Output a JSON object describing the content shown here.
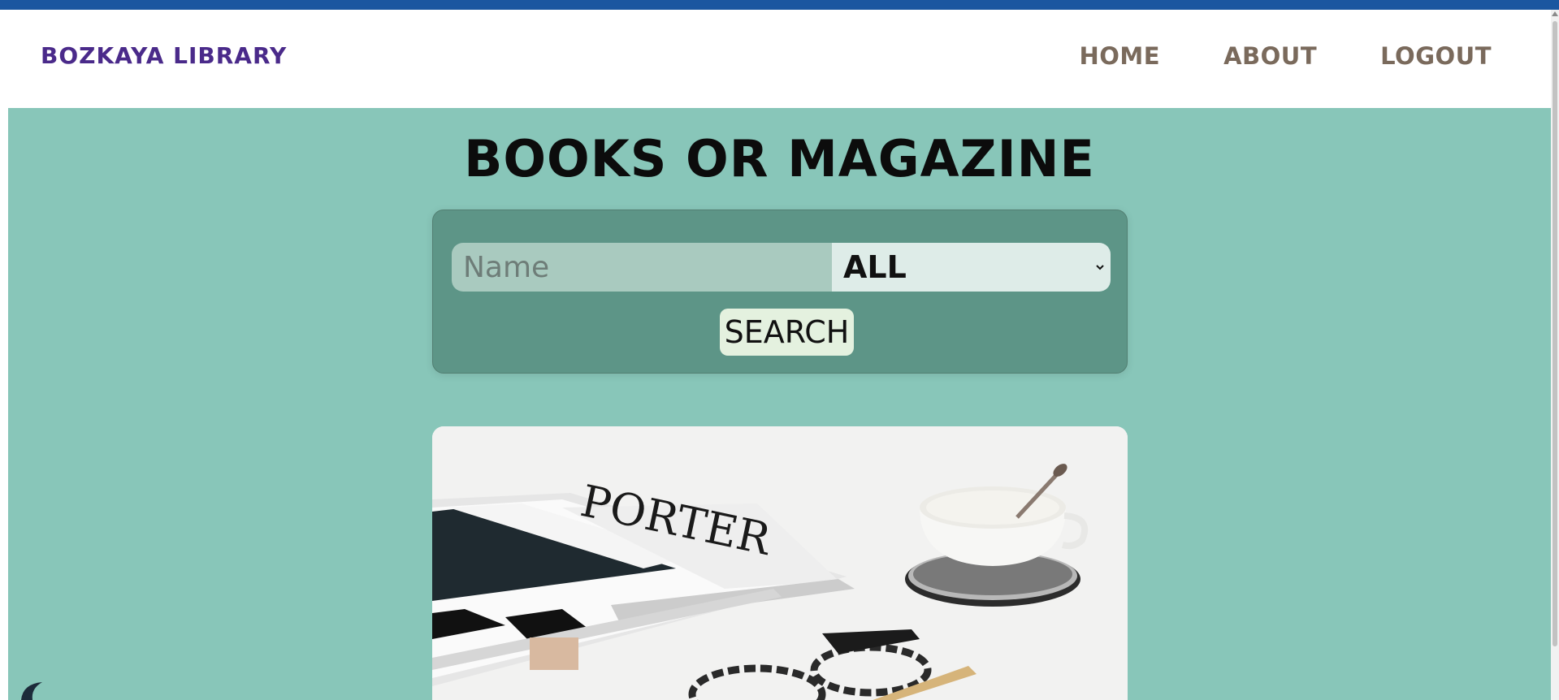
{
  "header": {
    "brand": "BOZKAYA LIBRARY",
    "nav": [
      "HOME",
      "ABOUT",
      "LOGOUT"
    ]
  },
  "main": {
    "title": "BOOKS OR MAGAZINE",
    "search": {
      "name_placeholder": "Name",
      "name_value": "",
      "type_selected": "ALL",
      "button_label": "SEARCH"
    }
  },
  "colors": {
    "top_strip": "#1b56a0",
    "brand": "#4a2a8a",
    "nav": "#7a6a5c",
    "main_bg": "#88c6b9",
    "card_bg": "#5d9587",
    "button_bg": "#e4f1df"
  },
  "icons": {
    "select_chevron": "chevron-down-icon"
  }
}
